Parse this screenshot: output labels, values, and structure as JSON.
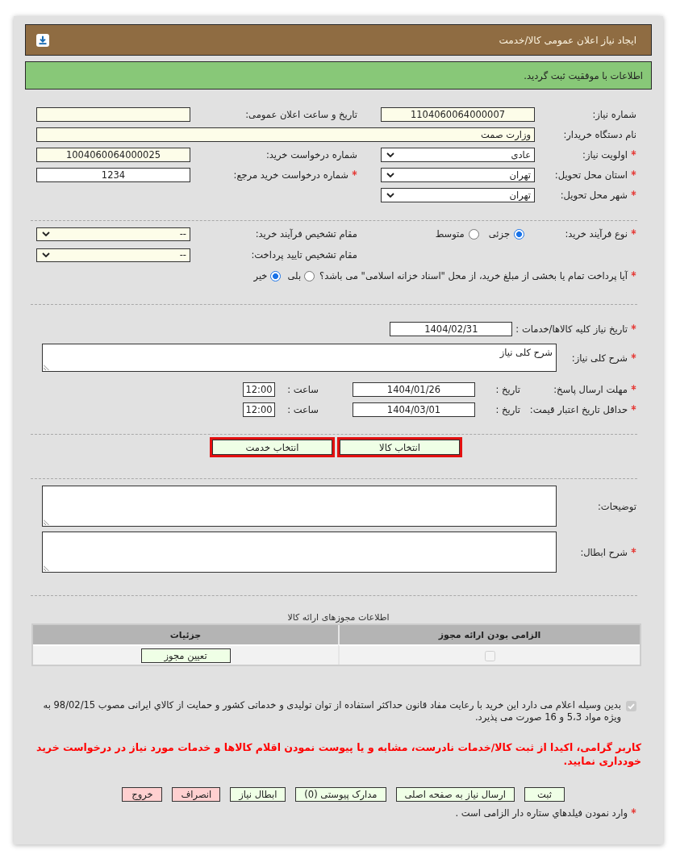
{
  "header": {
    "title": "ایجاد نیاز اعلان عمومی کالا/خدمت"
  },
  "alert": {
    "text": "اطلاعات با موفقیت ثبت گردید."
  },
  "basic_rows": [
    {
      "fields": [
        {
          "kind": "text",
          "label": "شماره نیاز:",
          "required": false,
          "readonly": true,
          "value": "1104060064000007"
        },
        {
          "kind": "text",
          "label": "تاریخ و ساعت اعلان عمومی:",
          "required": false,
          "readonly": true
        }
      ]
    },
    {
      "fields": [
        {
          "kind": "wide",
          "label": "نام دستگاه خریدار:",
          "required": false,
          "readonly": true,
          "value": "وزارت صمت"
        }
      ]
    },
    {
      "fields": [
        {
          "kind": "select",
          "label": "اولویت نیاز:",
          "required": true,
          "readonly": false,
          "value": "عادی"
        },
        {
          "kind": "text",
          "label": "شماره درخواست خرید:",
          "required": false,
          "readonly": true,
          "value": "1004060064000025"
        }
      ]
    },
    {
      "fields": [
        {
          "kind": "select",
          "label": "استان محل تحویل:",
          "required": true,
          "readonly": false,
          "value": "تهران"
        },
        {
          "kind": "text",
          "label": "شماره درخواست خرید مرجع:",
          "required": true,
          "readonly": false,
          "value": "1234"
        }
      ]
    },
    {
      "fields": [
        {
          "kind": "select",
          "label": "شهر محل تحویل:",
          "required": true,
          "readonly": false,
          "value": "تهران"
        }
      ]
    }
  ],
  "process": {
    "purchase_type": {
      "label": "نوع فرآیند خرید:",
      "required": true,
      "options": [
        {
          "label": "جزئی",
          "selected": true
        },
        {
          "label": "متوسط",
          "selected": false
        }
      ]
    },
    "authorities": [
      {
        "label": "مقام تشخیص فرآیند خرید:",
        "required": false,
        "readonly": true,
        "value": "--"
      },
      {
        "label": "مقام تشخیص تایید پرداخت:",
        "required": false,
        "readonly": true,
        "value": "--"
      }
    ],
    "treasury": {
      "label": "آیا پرداخت تمام یا بخشی از مبلغ خرید، از محل \"اسناد خزانه اسلامی\" می باشد؟",
      "required": true,
      "options": [
        {
          "label": "بلی",
          "selected": false
        },
        {
          "label": "خیر",
          "selected": true
        }
      ]
    }
  },
  "schedule": {
    "need_date": {
      "label": "تاریخ نیاز کلیه کالاها/خدمات :",
      "required": true,
      "value": "1404/02/31"
    },
    "description": {
      "label": "شرح کلی نیاز:",
      "required": true,
      "value": "شرح کلی نیاز"
    },
    "deadlines": [
      {
        "label": "مهلت ارسال پاسخ:",
        "required": true,
        "date_label": "تاریخ :",
        "date": "1404/01/26",
        "time_label": "ساعت :",
        "time": "12:00"
      },
      {
        "label": "حداقل تاریخ اعتبار قیمت:",
        "required": true,
        "date_label": "تاریخ :",
        "date": "1404/03/01",
        "time_label": "ساعت :",
        "time": "12:00"
      }
    ]
  },
  "item_buttons": [
    {
      "label": "انتخاب کالا",
      "highlighted": true
    },
    {
      "label": "انتخاب خدمت",
      "highlighted": true
    }
  ],
  "remarks": [
    {
      "label": "توضیحات:",
      "required": false
    },
    {
      "label": "شرح ابطال:",
      "required": true
    }
  ],
  "permits": {
    "caption": "اطلاعات مجوزهای ارائه کالا",
    "columns": [
      "الزامی بودن ارائه مجوز",
      "جزئیات"
    ],
    "rows": [
      {
        "permit_required": {
          "checked": false,
          "disabled": true
        },
        "action": "تعیین مجوز"
      }
    ]
  },
  "declaration": {
    "checked": true,
    "disabled": true,
    "text": "بدین وسیله اعلام می دارد این خرید با رعایت مفاد قانون حداکثر استفاده از توان تولیدی و خدماتی کشور و حمایت از کالاي ایرانی مصوب 98/02/15 به ویژه مواد 5،3 و 16 صورت می پذیرد."
  },
  "warning": "کاربر گرامی، اکیدا از ثبت کالا/خدمات نادرست، مشابه و یا پیوست نمودن اقلام کالاها و خدمات مورد نیاز در درخواست خرید خودداری نمایید.",
  "actions": [
    {
      "label": "ثبت",
      "kind": "default"
    },
    {
      "label": "ارسال نیاز به صفحه اصلی",
      "kind": "default"
    },
    {
      "label": "مدارک پیوستی (0)",
      "kind": "default"
    },
    {
      "label": "ابطال نیاز",
      "kind": "default"
    },
    {
      "label": "انصراف",
      "kind": "danger"
    },
    {
      "label": "خروج",
      "kind": "danger"
    }
  ],
  "required_note": "وارد نمودن فیلدهاي ستاره دار الزامی است ."
}
